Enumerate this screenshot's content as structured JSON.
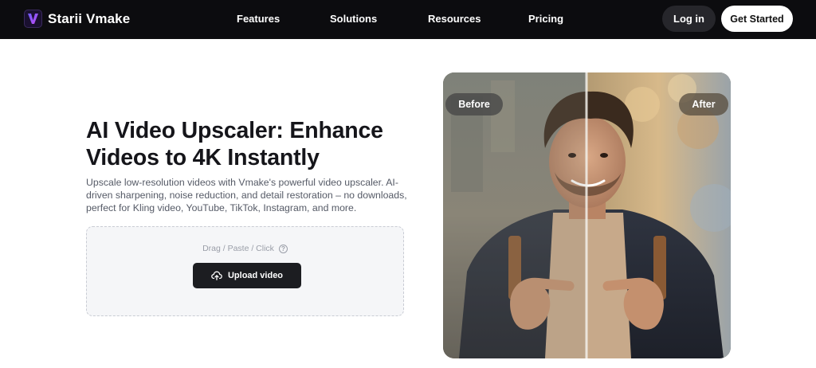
{
  "nav": {
    "brand": "Starii Vmake",
    "brand_logo_letter": "V",
    "items": [
      {
        "label": "Features"
      },
      {
        "label": "Solutions"
      },
      {
        "label": "Resources"
      },
      {
        "label": "Pricing"
      }
    ],
    "login_label": "Log in",
    "get_started_label": "Get Started"
  },
  "hero": {
    "title": "AI Video Upscaler: Enhance Videos to 4K Instantly",
    "description": "Upscale low-resolution videos with Vmake's powerful video upscaler. AI-driven sharpening, noise reduction, and detail restoration – no downloads, perfect for Kling video, YouTube, TikTok, Instagram, and more.",
    "upload": {
      "hint": "Drag / Paste / Click",
      "button_label": "Upload video",
      "button_icon": "cloud-upload-icon",
      "hint_icon": "help-circle-icon"
    }
  },
  "comparison": {
    "before_label": "Before",
    "after_label": "After"
  },
  "colors": {
    "nav_bg": "#0c0c0f",
    "accent_purple": "#8b5cf6",
    "button_dark": "#1c1d21"
  }
}
